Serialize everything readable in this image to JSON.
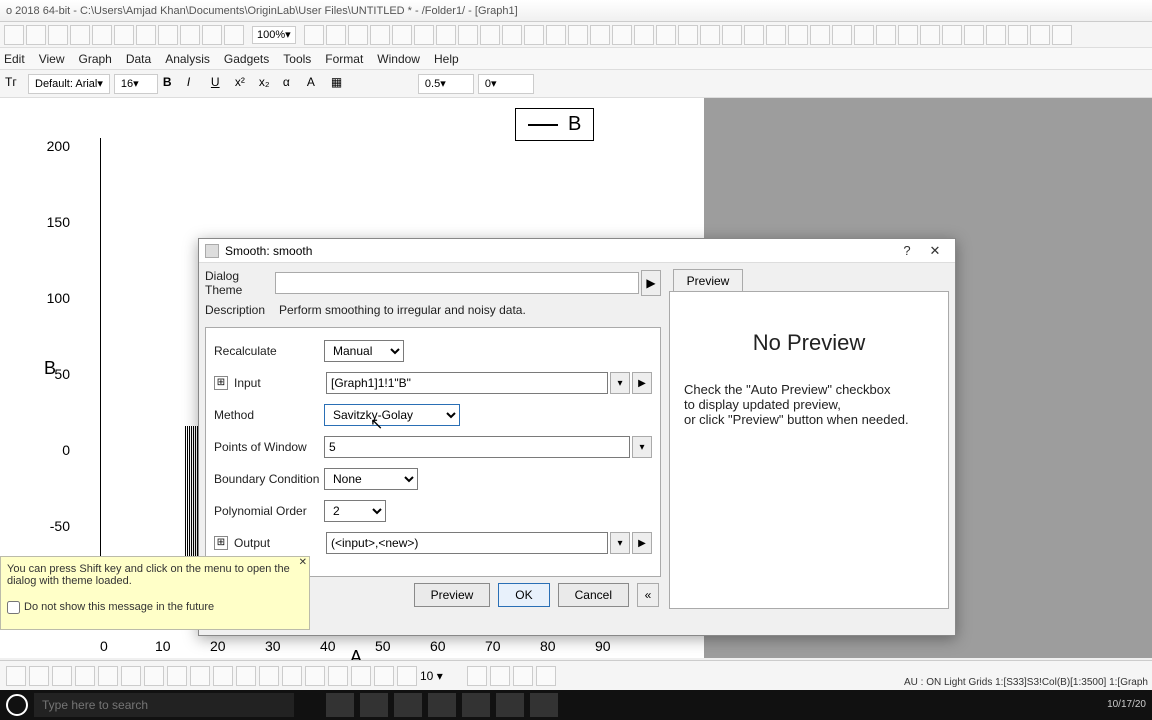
{
  "window": {
    "title": "o 2018 64-bit - C:\\Users\\Amjad Khan\\Documents\\OriginLab\\User Files\\UNTITLED * - /Folder1/ - [Graph1]"
  },
  "zoom": "100%",
  "menu": [
    "Edit",
    "View",
    "Graph",
    "Data",
    "Analysis",
    "Gadgets",
    "Tools",
    "Format",
    "Window",
    "Help"
  ],
  "font": {
    "name": "Default: Arial",
    "size": "16"
  },
  "line_width": "0.5",
  "line_width2": "0",
  "chart_data": {
    "type": "line",
    "title": "",
    "xlabel": "A",
    "ylabel": "B",
    "xticks": [
      0,
      10,
      20,
      30,
      40,
      50,
      60,
      70,
      80,
      90
    ],
    "yticks": [
      -50,
      0,
      50,
      100,
      150,
      200
    ],
    "legend": [
      "B"
    ]
  },
  "dialog": {
    "title": "Smooth: smooth",
    "theme_label": "Dialog Theme",
    "desc_label": "Description",
    "desc_text": "Perform smoothing to irregular and noisy data.",
    "recalc_label": "Recalculate",
    "recalc_value": "Manual",
    "input_label": "Input",
    "input_value": "[Graph1]1!1\"B\"",
    "method_label": "Method",
    "method_value": "Savitzky-Golay",
    "points_label": "Points of Window",
    "points_value": "5",
    "boundary_label": "Boundary Condition",
    "boundary_value": "None",
    "poly_label": "Polynomial Order",
    "poly_value": "2",
    "output_label": "Output",
    "output_value": "(<input>,<new>)",
    "auto_preview": "Auto Preview",
    "preview_btn": "Preview",
    "ok_btn": "OK",
    "cancel_btn": "Cancel",
    "preview_tab": "Preview",
    "no_preview": "No Preview",
    "preview_hint1": "Check the \"Auto Preview\" checkbox",
    "preview_hint2": "to display updated preview,",
    "preview_hint3": "or click \"Preview\" button when needed."
  },
  "tooltip": {
    "text": "You can press Shift key and click on the menu to open the dialog with theme loaded.",
    "checkbox": "Do not show this message in the future"
  },
  "status": {
    "size": "10",
    "right": "AU : ON  Light Grids  1:[S33]S3!Col(B)[1:3500]  1:[Graph"
  },
  "taskbar": {
    "search_placeholder": "Type here to search",
    "time": "10/17/20"
  }
}
